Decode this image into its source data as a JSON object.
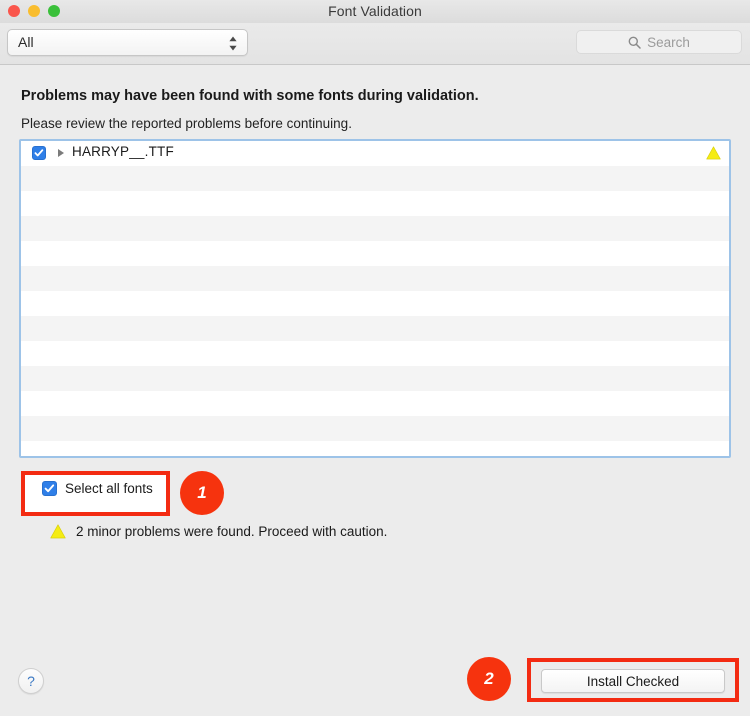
{
  "window": {
    "title": "Font Validation",
    "traffic_lights": [
      {
        "name": "close",
        "color": "#fa564c"
      },
      {
        "name": "minimize",
        "color": "#f9bd2e"
      },
      {
        "name": "zoom",
        "color": "#3ac03a"
      }
    ]
  },
  "toolbar": {
    "filter_popup": {
      "selected": "All",
      "options": [
        "All"
      ]
    },
    "search": {
      "value": "",
      "placeholder": "Search",
      "icon": "search-icon"
    }
  },
  "content": {
    "headline": "Problems may have been found with some fonts during validation.",
    "subline": "Please review the reported problems before continuing.",
    "list": {
      "total_rows": 12,
      "rows": [
        {
          "checked": true,
          "expanded": false,
          "disclosure": "disclosure-triangle-right",
          "label": "HARRYP__.TTF",
          "status_icon": "warning-triangle-icon",
          "status_color": "#f5ec13"
        }
      ]
    },
    "select_all": {
      "label": "Select all fonts",
      "checked": true
    },
    "note": {
      "icon": "warning-triangle-icon",
      "icon_color": "#f5ec13",
      "text": "2 minor problems were found. Proceed with caution."
    }
  },
  "footer": {
    "help_button": {
      "label": "?",
      "icon": "question-mark-icon"
    },
    "install_button": {
      "label": "Install Checked"
    }
  },
  "annotations": {
    "accent_color": "#f32b12",
    "badges": [
      {
        "number": "1",
        "target": "select-all-fonts-checkbox"
      },
      {
        "number": "2",
        "target": "install-checked-button"
      }
    ]
  },
  "colors": {
    "window_background": "#ececec",
    "list_focus_border": "#9dc3e8",
    "checkbox_blue": "#2f7fe8",
    "warning_yellow": "#f5ec13",
    "annotation_red": "#f32b12",
    "help_blue": "#3b78c3"
  }
}
